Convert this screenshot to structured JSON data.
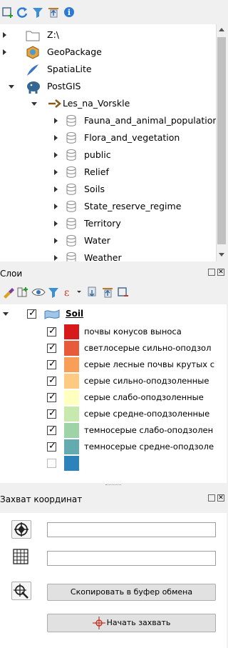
{
  "browser": {
    "toolbar_icons": [
      "add-layer-icon",
      "refresh-icon",
      "filter-icon",
      "collapse-all-icon",
      "info-icon"
    ],
    "items": {
      "z_drive": "Z:\\",
      "geopackage": "GeoPackage",
      "spatialite": "SpatiaLite",
      "postgis": "PostGIS",
      "connection": "Les_na_Vorskle",
      "schemas": [
        "Fauna_and_animal_population",
        "Flora_and_vegetation",
        "public",
        "Relief",
        "Soils",
        "State_reserve_regime",
        "Territory",
        "Water",
        "Weather"
      ]
    }
  },
  "layers": {
    "title": "Слои",
    "layer_name": "Soil",
    "classes": [
      {
        "label": "почвы конусов выноса",
        "color": "#d7191c",
        "checked": true
      },
      {
        "label": "светлосерые сильно-оподзол",
        "color": "#e85b3a",
        "checked": true
      },
      {
        "label": "серые лесные почвы крутых с",
        "color": "#f99e59",
        "checked": true
      },
      {
        "label": "серые сильно-оподзоленные",
        "color": "#fec980",
        "checked": true
      },
      {
        "label": "серые слабо-оподзоленные",
        "color": "#ffffc0",
        "checked": true
      },
      {
        "label": "серые средне-оподзоленные",
        "color": "#c7e9ad",
        "checked": true
      },
      {
        "label": "темносерые слабо-оподзолен",
        "color": "#9dd3a6",
        "checked": true
      },
      {
        "label": "темносерые средне-оподзоле",
        "color": "#64abb0",
        "checked": true
      },
      {
        "label": "",
        "color": "#2b83ba",
        "checked": false
      }
    ]
  },
  "coord": {
    "title": "Захват координат",
    "field1_value": "",
    "field2_value": "",
    "copy_label": "Скопировать в буфер обмена",
    "start_label": "Начать захвать"
  }
}
